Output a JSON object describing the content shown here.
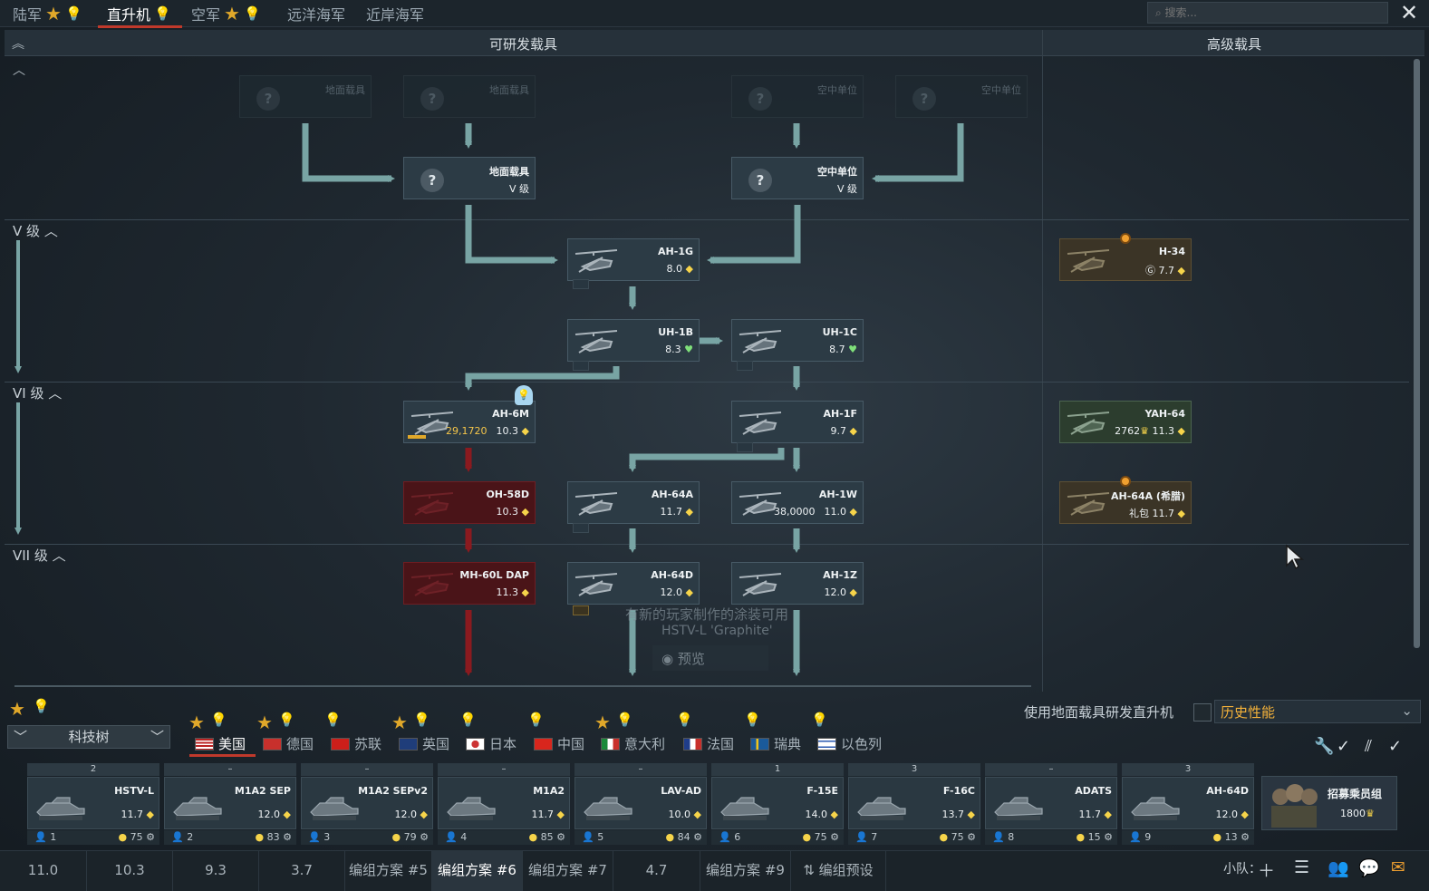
{
  "top_tabs": {
    "ground": "陆军",
    "helicopters": "直升机",
    "air": "空军",
    "bluewater": "远洋海军",
    "coastal": "近岸海军"
  },
  "search": {
    "placeholder": "⌕ 搜索..."
  },
  "headers": {
    "researchable": "可研发载具",
    "premium": "高级载具"
  },
  "ranks": {
    "r5": "V 级",
    "r6": "VI 级",
    "r7": "VII 级"
  },
  "cards": {
    "q1": {
      "name": "地面载具"
    },
    "q2": {
      "name": "地面载具"
    },
    "q3": {
      "name": "空中单位"
    },
    "q4": {
      "name": "空中单位"
    },
    "ground5": {
      "name": "地面载具",
      "rank": "V 级"
    },
    "air5": {
      "name": "空中单位",
      "rank": "V 级"
    },
    "ah1g": {
      "name": "AH-1G",
      "br": "8.0"
    },
    "uh1b": {
      "name": "UH-1B",
      "br": "8.3"
    },
    "uh1c": {
      "name": "UH-1C",
      "br": "8.7"
    },
    "ah6m": {
      "name": "AH-6M",
      "cost": "29,1720",
      "br": "10.3"
    },
    "ah1f": {
      "name": "AH-1F",
      "br": "9.7"
    },
    "oh58d": {
      "name": "OH-58D",
      "br": "10.3"
    },
    "ah64a": {
      "name": "AH-64A",
      "br": "11.7"
    },
    "ah1w": {
      "name": "AH-1W",
      "cost": "38,0000",
      "br": "11.0"
    },
    "mh60l": {
      "name": "MH-60L DAP",
      "br": "11.3"
    },
    "ah64d": {
      "name": "AH-64D",
      "br": "12.0"
    },
    "ah1z": {
      "name": "AH-1Z",
      "br": "12.0"
    },
    "h34": {
      "name": "H-34",
      "br": "7.7"
    },
    "yah64": {
      "name": "YAH-64",
      "cost": "2762",
      "br": "11.3"
    },
    "ah64a_gr": {
      "name": "AH-64A (希腊)",
      "pack": "礼包",
      "br": "11.7"
    }
  },
  "notice": {
    "line1": "有新的玩家制作的涂装可用",
    "line2": "HSTV-L 'Graphite'",
    "preview": "预览"
  },
  "toggle": {
    "label": "使用地面载具研发直升机",
    "mode": "历史性能"
  },
  "techtree_button": "科技树",
  "nations": [
    "美国",
    "德国",
    "苏联",
    "英国",
    "日本",
    "中国",
    "意大利",
    "法国",
    "瑞典",
    "以色列"
  ],
  "slots": [
    {
      "top": "2",
      "name": "HSTV-L",
      "br": "11.7",
      "num": "1",
      "pts": "75"
    },
    {
      "top": "–",
      "name": "M1A2 SEP",
      "br": "12.0",
      "num": "2",
      "pts": "83"
    },
    {
      "top": "–",
      "name": "M1A2 SEPv2",
      "br": "12.0",
      "num": "3",
      "pts": "79"
    },
    {
      "top": "–",
      "name": "M1A2",
      "br": "11.7",
      "num": "4",
      "pts": "85"
    },
    {
      "top": "–",
      "name": "LAV-AD",
      "br": "10.0",
      "num": "5",
      "pts": "84"
    },
    {
      "top": "1",
      "name": "F-15E",
      "br": "14.0",
      "num": "6",
      "pts": "75"
    },
    {
      "top": "3",
      "name": "F-16C",
      "br": "13.7",
      "num": "7",
      "pts": "75"
    },
    {
      "top": "–",
      "name": "ADATS",
      "br": "11.7",
      "num": "8",
      "pts": "15"
    },
    {
      "top": "3",
      "name": "AH-64D",
      "br": "12.0",
      "num": "9",
      "pts": "13"
    }
  ],
  "recruit": {
    "label": "招募乘员组",
    "cost": "1800"
  },
  "presets": [
    "11.0",
    "10.3",
    "9.3",
    "3.7",
    "编组方案 #5",
    "编组方案 #6",
    "编组方案 #7",
    "4.7",
    "编组方案 #9",
    "⇅ 编组预设"
  ],
  "squad": "小队："
}
